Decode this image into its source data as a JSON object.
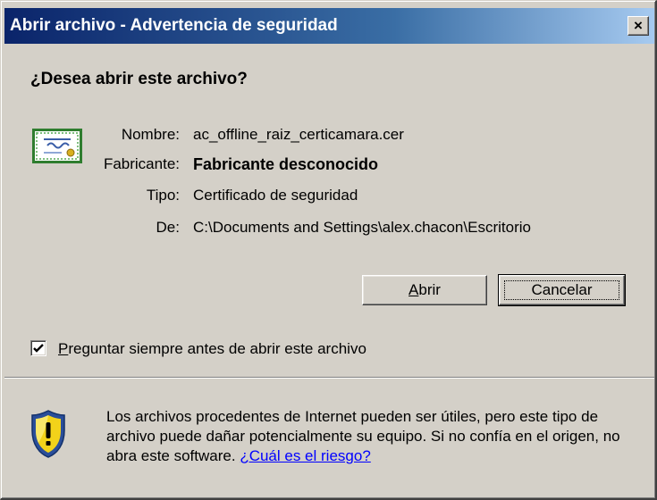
{
  "window": {
    "title": "Abrir archivo - Advertencia de seguridad",
    "close_glyph": "×"
  },
  "dialog": {
    "question": "¿Desea abrir este archivo?",
    "fields": {
      "name_label": "Nombre:",
      "name_value": "ac_offline_raiz_certicamara.cer",
      "publisher_label": "Fabricante:",
      "publisher_value": "Fabricante desconocido",
      "type_label": "Tipo:",
      "type_value": "Certificado de seguridad",
      "from_label": "De:",
      "from_value": "C:\\Documents and Settings\\alex.chacon\\Escritorio"
    },
    "buttons": {
      "open_access": "A",
      "open_rest": "brir",
      "cancel": "Cancelar"
    },
    "checkbox": {
      "checked": true,
      "label_access": "P",
      "label_rest": "reguntar siempre antes de abrir este archivo"
    },
    "warning": {
      "text": "Los archivos procedentes de Internet pueden ser útiles, pero este tipo de archivo puede dañar potencialmente su equipo. Si no confía en el origen, no abra este software. ",
      "link": "¿Cuál es el riesgo?"
    }
  },
  "icons": {
    "certificate": "certificate-icon",
    "shield": "warning-shield-icon",
    "check": "checkmark-icon",
    "close": "close-icon"
  },
  "colors": {
    "title_bar_start": "#0a246a",
    "title_bar_end": "#a6caf0",
    "dialog_bg": "#d4d0c8",
    "link": "#0000ff"
  }
}
